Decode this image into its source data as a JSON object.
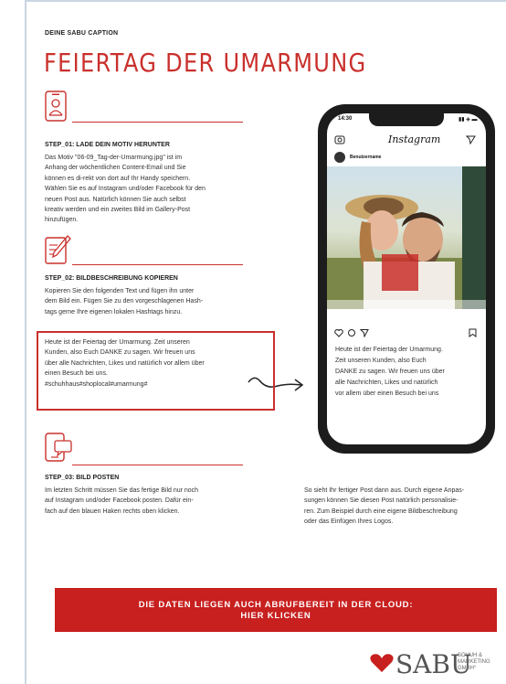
{
  "caption": "DEINE SABU CAPTION",
  "title": "FEIERTAG DER UMARMUNG",
  "step1": {
    "title": "STEP_01: LADE DEIN MOTIV HERUNTER",
    "lines": [
      "Das Motiv \"06-09_Tag-der-Umarmung.jpg\" ist im",
      "Anhang der wöchentlichen Content-Email und Sie",
      "können es di-rekt von dort auf Ihr Handy speichern.",
      "Wählen Sie es auf Instagram und/oder Facebook für den",
      "neuen Post aus. Natürlich können Sie auch selbst",
      "kreativ werden und ein zweites Bild im Gallery-Post",
      "hinzufügen."
    ]
  },
  "step2": {
    "title": "STEP_02: BILDBESCHREIBUNG KOPIEREN",
    "lines": [
      "Kopieren Sie den folgenden Text und fügen ihn unter",
      "dem Bild ein. Fügen Sie zu den vorgeschlagenen Hash-",
      "tags gerne Ihre eigenen lokalen Hashtags hinzu."
    ]
  },
  "caption_box": {
    "lines": [
      "Heute ist der Feiertag der Umarmung. Zeit unseren",
      "Kunden, also Euch DANKE zu sagen. Wir freuen uns",
      "über alle Nachrichten, Likes und natürlich vor allem über",
      "einen Besuch bei uns.",
      "#schuhhaus#shoplocal#umarmung#"
    ]
  },
  "step3": {
    "title": "STEP_03: BILD POSTEN",
    "lines": [
      "Im letzten Schritt müssen Sie das fertige Bild nur noch",
      "auf Instagram und/oder Facebook posten. Dafür ein-",
      "fach auf den blauen Haken rechts oben klicken."
    ]
  },
  "right_note": {
    "lines": [
      "So sieht Ihr fertiger Post dann aus. Durch eigene Anpas-",
      "sungen können Sie diesen Post natürlich personalisie-",
      "ren. Zum Beispiel durch eine eigene Bildbeschreibung",
      "oder das Einfügen Ihres Logos."
    ]
  },
  "phone": {
    "time": "14:30",
    "status": "▮▮ ◈ ▬",
    "app_name": "Instagram",
    "username": "Benutzername",
    "post_lines": [
      "Heute ist der Feiertag der Umarmung.",
      "Zeit unseren Kunden, also Euch",
      "DANKE zu sagen. Wir freuen uns über",
      "alle Nachrichten, Likes und natürlich",
      "vor allem über einen Besuch bei uns"
    ]
  },
  "cta": {
    "line1": "DIE DATEN LIEGEN AUCH ABRUFBEREIT IN DER CLOUD:",
    "line2": "HIER KLICKEN"
  },
  "logo": {
    "name": "SABU",
    "sub1": "SCHUH &",
    "sub2": "MARKETING",
    "sub3": "GMBH°"
  },
  "colors": {
    "accent": "#c9302c",
    "cta": "#c81f1f"
  }
}
